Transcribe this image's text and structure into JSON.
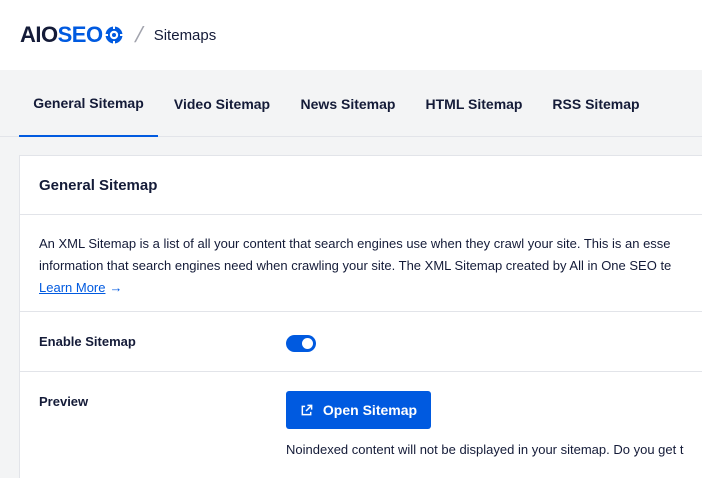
{
  "header": {
    "logo_prefix": "AIO",
    "logo_suffix": "SEO",
    "separator": "/",
    "breadcrumb": "Sitemaps"
  },
  "tabs": [
    {
      "label": "General Sitemap",
      "active": true
    },
    {
      "label": "Video Sitemap",
      "active": false
    },
    {
      "label": "News Sitemap",
      "active": false
    },
    {
      "label": "HTML Sitemap",
      "active": false
    },
    {
      "label": "RSS Sitemap",
      "active": false
    }
  ],
  "card": {
    "title": "General Sitemap",
    "description_line1": "An XML Sitemap is a list of all your content that search engines use when they crawl your site. This is an esse",
    "description_line2": "information that search engines need when crawling your site. The XML Sitemap created by All in One SEO te",
    "learn_more": "Learn More",
    "learn_more_arrow": "→"
  },
  "settings": {
    "enable_label": "Enable Sitemap",
    "enable_state": true,
    "preview_label": "Preview",
    "open_button": "Open Sitemap",
    "note": "Noindexed content will not be displayed in your sitemap. Do you get t"
  },
  "colors": {
    "accent": "#005ae0",
    "text": "#141b38",
    "background": "#f3f4f5"
  },
  "icons": {
    "logo_cog": "gear-icon",
    "open_button_icon": "external-link-icon"
  }
}
